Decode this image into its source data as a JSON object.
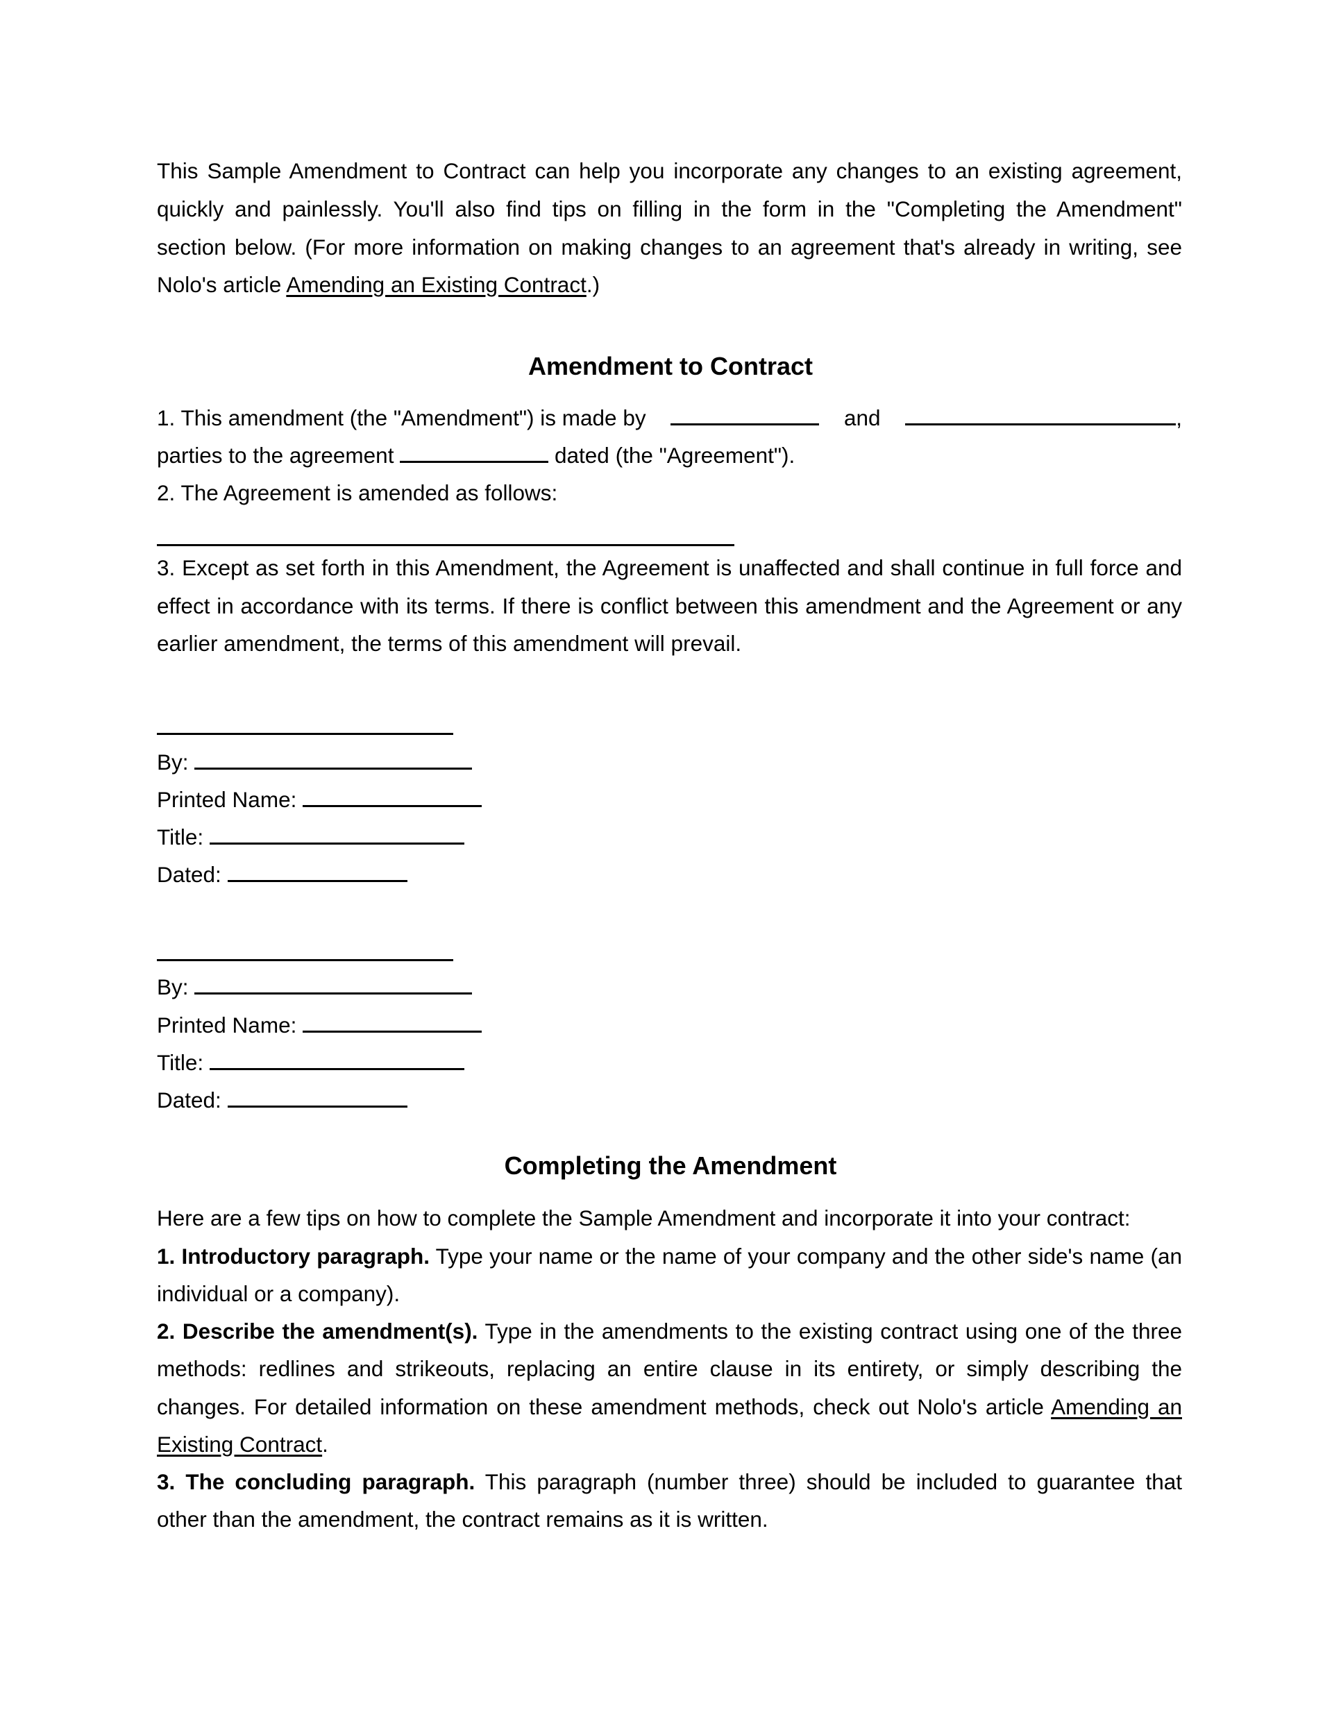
{
  "intro": {
    "lines": [
      "This Sample Amendment to Contract can help you incorporate any changes to an existing agreement,",
      "quickly and painlessly. You'll also find tips on filling in the form in the \"Completing the Amendment\"",
      "section below. (For more information on making changes to an agreement that's already in writing, see"
    ],
    "last_prefix": "Nolo's article ",
    "link_text": "Amending an Existing Contract",
    "last_suffix": ".)"
  },
  "amendment": {
    "title": "Amendment to Contract",
    "item1_prefix": "1. This amendment (the \"Amendment\") is made by",
    "item1_and": "and",
    "item1_comma": ",",
    "item1_line2_prefix": "parties to the agreement",
    "item1_line2_suffix": "dated (the \"Agreement\").",
    "item2": "2. The Agreement is amended as follows:",
    "item3_lines": [
      "3. Except as set forth in this Amendment, the Agreement is unaffected and shall continue in full force and",
      "effect in accordance with its terms. If there is conflict between this amendment and the Agreement or any",
      "earlier amendment, the terms of this amendment will prevail."
    ]
  },
  "signature_blocks": [
    {
      "by_label": "By:",
      "printed_name_label": "Printed Name:",
      "title_label": "Title:",
      "dated_label": "Dated:",
      "by_value": "",
      "printed_name_value": "",
      "title_value": "",
      "dated_value": ""
    },
    {
      "by_label": "By:",
      "printed_name_label": "Printed Name:",
      "title_label": "Title:",
      "dated_label": "Dated:",
      "by_value": "",
      "printed_name_value": "",
      "title_value": "",
      "dated_value": ""
    }
  ],
  "completing": {
    "title": "Completing the Amendment",
    "intro": "Here are a few tips on how to complete the Sample Amendment and incorporate it into your contract:",
    "tip1_bold": "1. Introductory paragraph.",
    "tip1_line1": " Type your name or the name of your company and the other side's name (an",
    "tip1_line2": "individual or a company).",
    "tip2_bold": "2. Describe the amendment(s).",
    "tip2_line1": " Type in the amendments to the existing contract using one of the three",
    "tip2_line2": "methods: redlines and strikeouts, replacing an entire clause in its entirety, or simply describing the",
    "tip2_line3": "changes. For detailed information on these amendment methods, check out Nolo's article ",
    "tip2_link_part1": "Amending an",
    "tip2_link_part2": "Existing Contract",
    "tip2_line4_suffix": ".",
    "tip3_bold": "3. The concluding paragraph.",
    "tip3_line1": " This paragraph (number three) should be included to guarantee that",
    "tip3_line2": "other than the amendment, the contract remains as it is written."
  }
}
